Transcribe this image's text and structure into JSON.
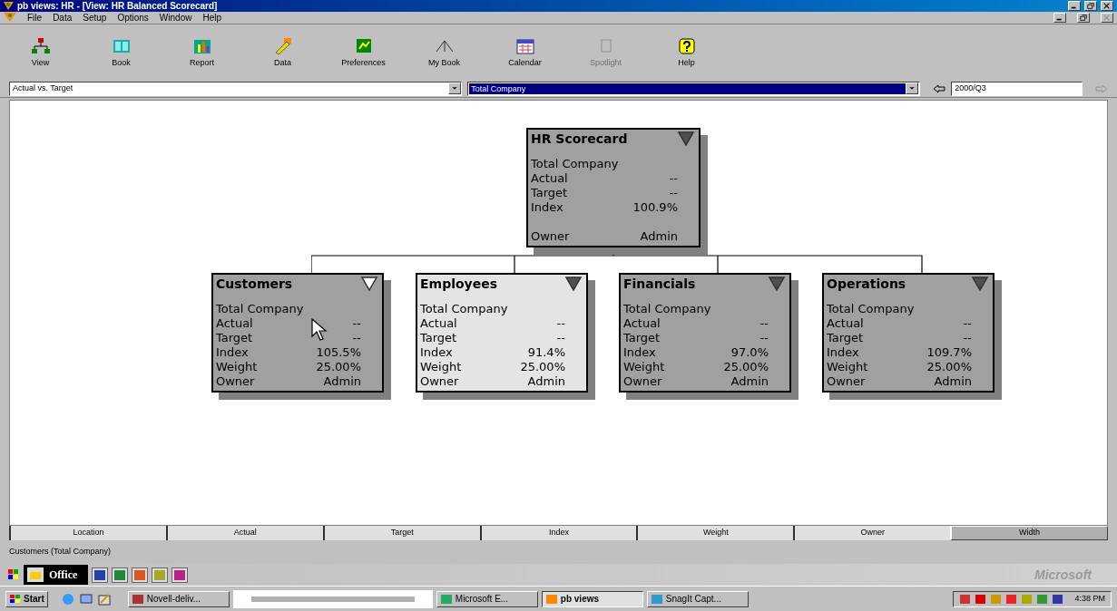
{
  "window": {
    "title": "pb views: HR - [View: HR Balanced Scorecard]"
  },
  "menu": [
    "File",
    "Data",
    "Setup",
    "Options",
    "Window",
    "Help"
  ],
  "toolbar": [
    {
      "label": "View",
      "kind": "view",
      "disabled": false
    },
    {
      "label": "Book",
      "kind": "book",
      "disabled": false
    },
    {
      "label": "Report",
      "kind": "report",
      "disabled": false
    },
    {
      "label": "Data",
      "kind": "data",
      "disabled": false
    },
    {
      "label": "Preferences",
      "kind": "preferences",
      "disabled": false
    },
    {
      "label": "My Book",
      "kind": "mybook",
      "disabled": false
    },
    {
      "label": "Calendar",
      "kind": "calendar",
      "disabled": false
    },
    {
      "label": "Spotlight",
      "kind": "spotlight",
      "disabled": true
    },
    {
      "label": "Help",
      "kind": "help",
      "disabled": false
    }
  ],
  "selectors": {
    "view": "Actual vs. Target",
    "location": "Total Company",
    "period": "2000/Q3"
  },
  "scorecard": {
    "title": "HR Scorecard",
    "highlighted": false,
    "arrow_filled": true,
    "location": "Total Company",
    "metrics": [
      {
        "label": "Actual",
        "value": "--"
      },
      {
        "label": "Target",
        "value": "--"
      },
      {
        "label": "Index",
        "value": "100.9%"
      }
    ],
    "owner": {
      "label": "Owner",
      "value": "Admin"
    },
    "children": [
      {
        "title": "Customers",
        "highlighted": false,
        "arrow_filled": false,
        "location": "Total Company",
        "metrics": [
          {
            "label": "Actual",
            "value": "--"
          },
          {
            "label": "Target",
            "value": "--"
          },
          {
            "label": "Index",
            "value": "105.5%"
          },
          {
            "label": "Weight",
            "value": "25.00%"
          }
        ],
        "owner": {
          "label": "Owner",
          "value": "Admin"
        }
      },
      {
        "title": "Employees",
        "highlighted": true,
        "arrow_filled": true,
        "location": "Total Company",
        "metrics": [
          {
            "label": "Actual",
            "value": "--"
          },
          {
            "label": "Target",
            "value": "--"
          },
          {
            "label": "Index",
            "value": "91.4%"
          },
          {
            "label": "Weight",
            "value": "25.00%"
          }
        ],
        "owner": {
          "label": "Owner",
          "value": "Admin"
        }
      },
      {
        "title": "Financials",
        "highlighted": false,
        "arrow_filled": true,
        "location": "Total Company",
        "metrics": [
          {
            "label": "Actual",
            "value": "--"
          },
          {
            "label": "Target",
            "value": "--"
          },
          {
            "label": "Index",
            "value": "97.0%"
          },
          {
            "label": "Weight",
            "value": "25.00%"
          }
        ],
        "owner": {
          "label": "Owner",
          "value": "Admin"
        }
      },
      {
        "title": "Operations",
        "highlighted": false,
        "arrow_filled": true,
        "location": "Total Company",
        "metrics": [
          {
            "label": "Actual",
            "value": "--"
          },
          {
            "label": "Target",
            "value": "--"
          },
          {
            "label": "Index",
            "value": "109.7%"
          },
          {
            "label": "Weight",
            "value": "25.00%"
          }
        ],
        "owner": {
          "label": "Owner",
          "value": "Admin"
        }
      }
    ]
  },
  "columns": [
    {
      "label": "Location",
      "selected": false
    },
    {
      "label": "Actual",
      "selected": false
    },
    {
      "label": "Target",
      "selected": false
    },
    {
      "label": "Index",
      "selected": false
    },
    {
      "label": "Weight",
      "selected": false
    },
    {
      "label": "Owner",
      "selected": false
    },
    {
      "label": "Width",
      "selected": true
    }
  ],
  "status_bar": "Customers (Total Company)",
  "office_bar": {
    "label": "Office",
    "brand": "Microsoft"
  },
  "taskbar": {
    "start": "Start",
    "tasks": [
      {
        "label": "Novell-deliv...",
        "selected": false
      },
      {
        "label": "Microsoft E...",
        "selected": false
      },
      {
        "label": "pb views",
        "selected": true
      },
      {
        "label": "SnagIt Capt...",
        "selected": false
      }
    ],
    "clock": "4:38 PM"
  }
}
